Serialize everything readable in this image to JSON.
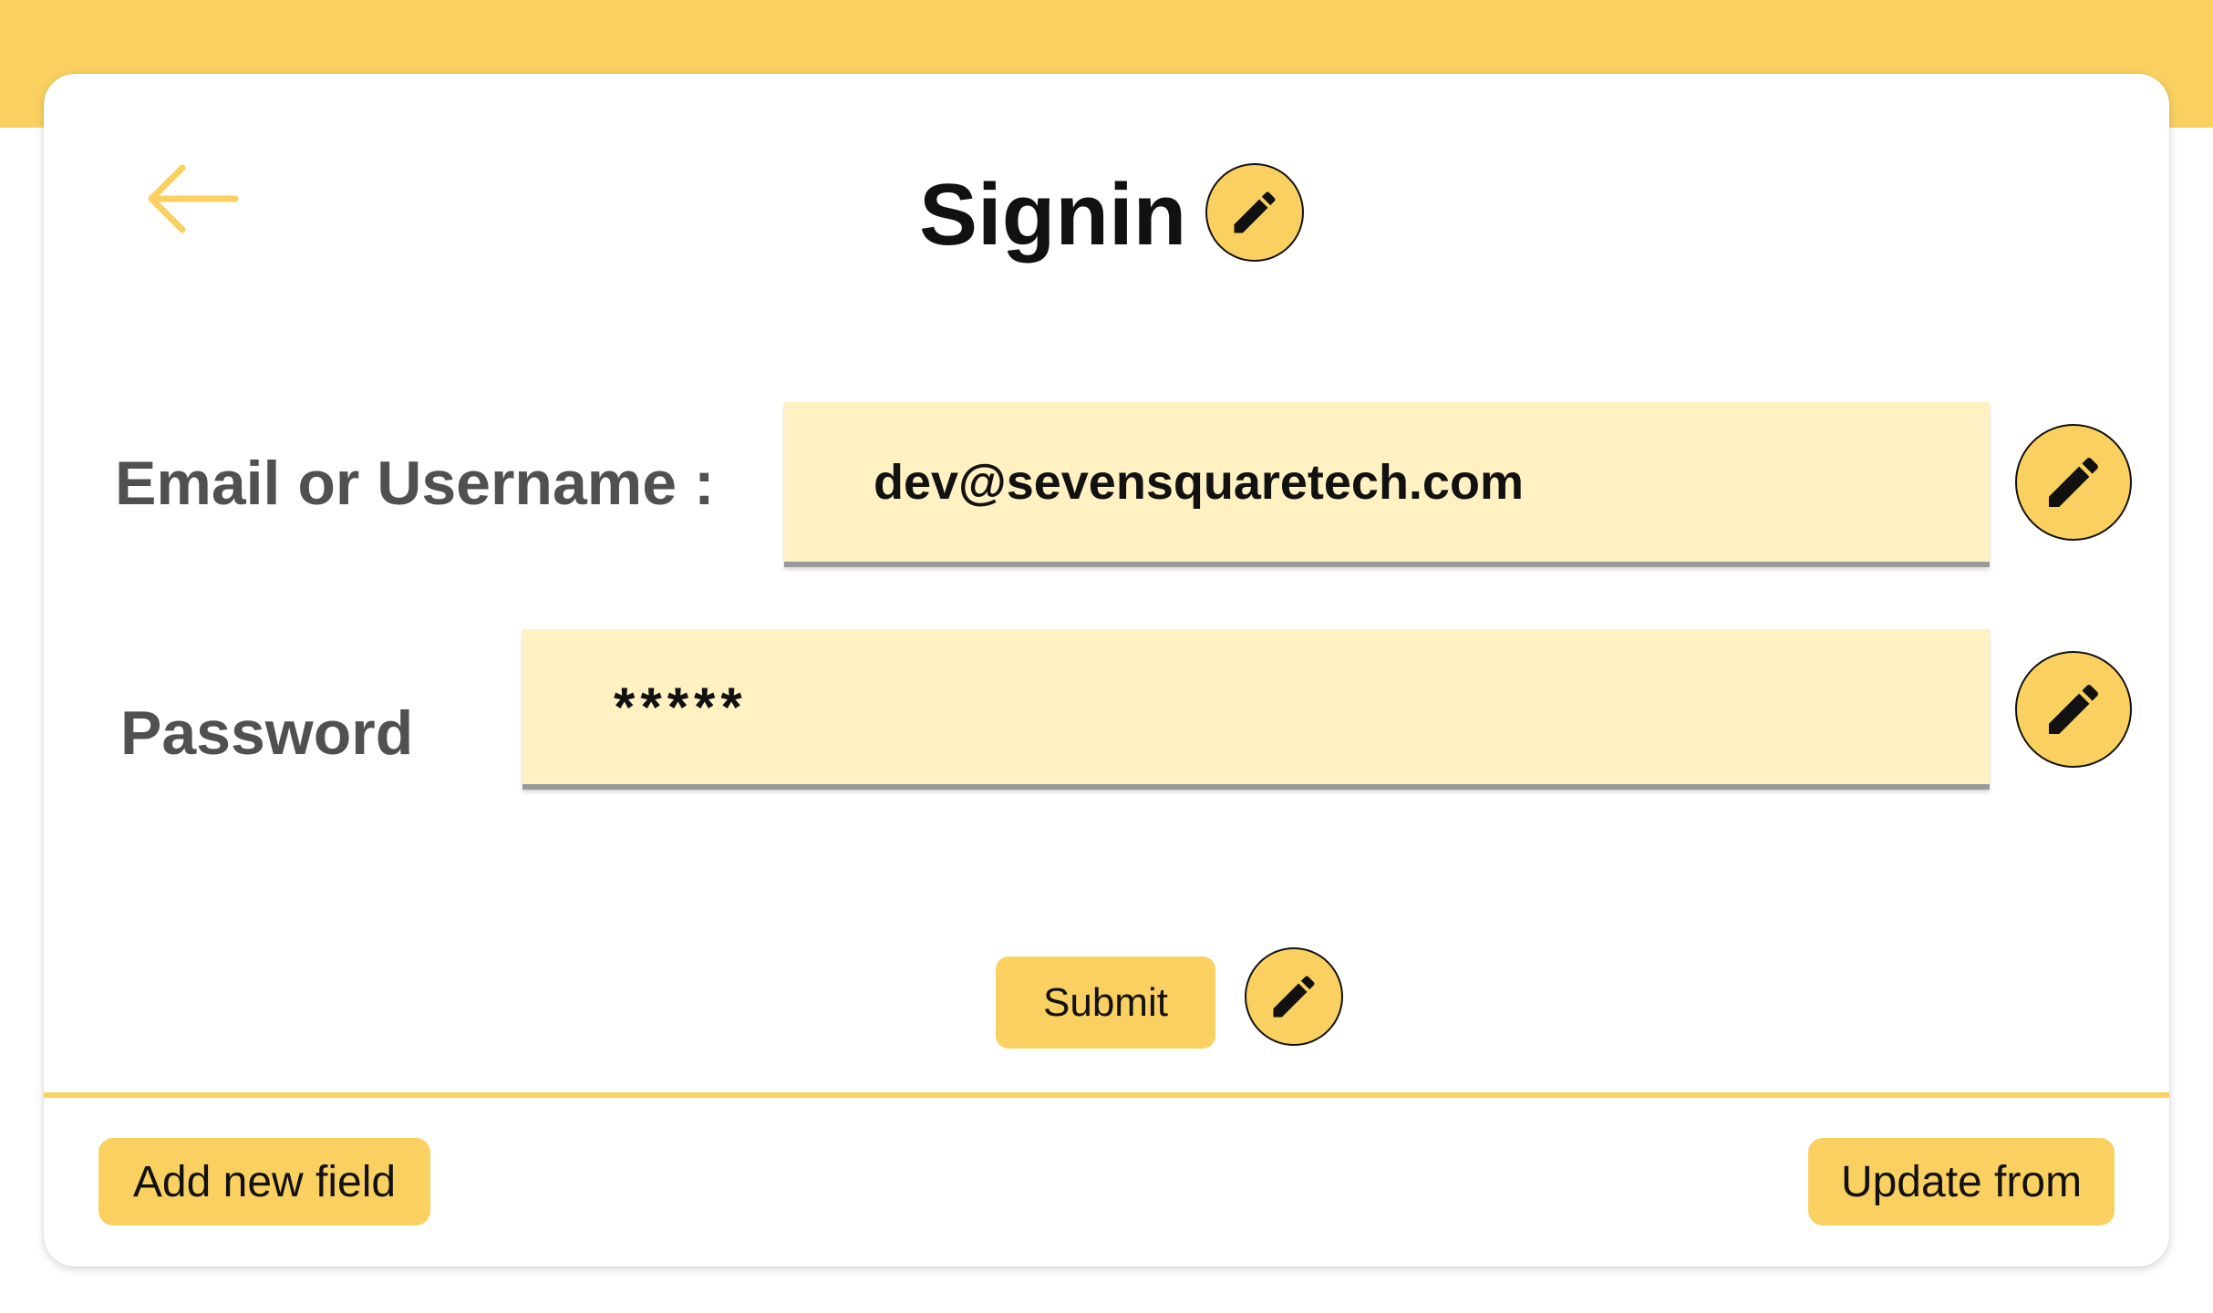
{
  "header": {
    "title": "Signin",
    "back_icon": "arrow-left-icon",
    "edit_icon": "pencil-icon"
  },
  "form": {
    "email": {
      "label": "Email or Username :",
      "value": "dev@sevensquaretech.com"
    },
    "password": {
      "label": "Password",
      "value": "*****"
    },
    "submit_label": "Submit"
  },
  "footer": {
    "add_field_label": "Add new field",
    "update_form_label": "Update from"
  },
  "colors": {
    "accent": "#FAD160",
    "field_background": "#FFF1C2",
    "label_text": "#505050",
    "title_text": "#111111"
  }
}
